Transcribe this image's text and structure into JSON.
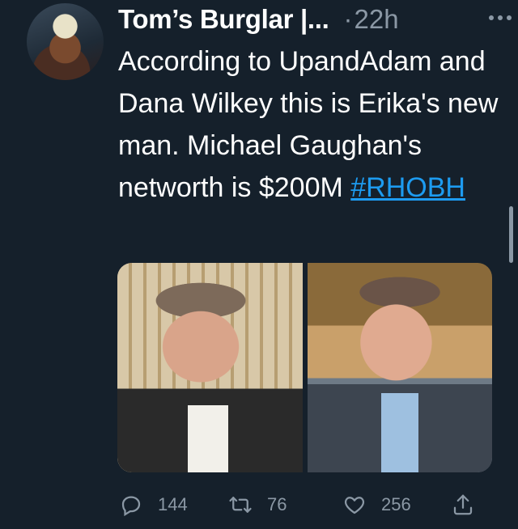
{
  "tweet": {
    "author": "Tom’s Burglar |...",
    "separator": "·",
    "time": "22h",
    "text_before": "According to UpandAdam and Dana Wilkey this is Erika's new man. Michael Gaughan's networth is $200M ",
    "hashtag": "#RHOBH"
  },
  "actions": {
    "replies": "144",
    "retweets": "76",
    "likes": "256"
  },
  "icons": [
    "avatar",
    "more-icon",
    "reply-icon",
    "retweet-icon",
    "like-icon",
    "share-icon"
  ],
  "colors": {
    "background": "#15202b",
    "text": "#ffffff",
    "muted": "#8b98a5",
    "link": "#1d9bf0"
  }
}
